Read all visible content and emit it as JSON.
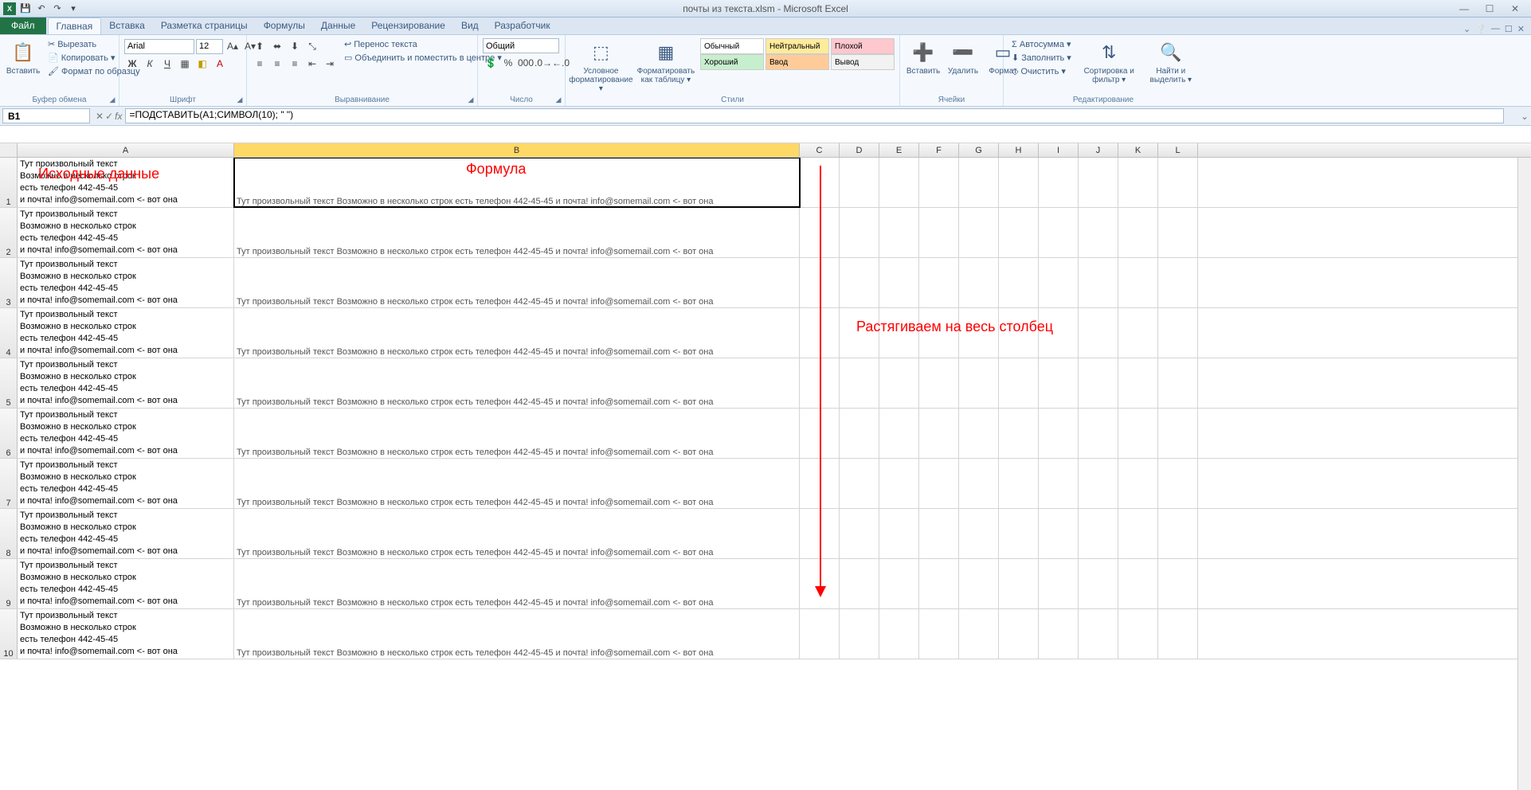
{
  "titlebar": {
    "title": "почты из текста.xlsm - Microsoft Excel",
    "qat_save": "💾",
    "qat_undo": "↶",
    "qat_redo": "↷"
  },
  "tabs": {
    "file": "Файл",
    "items": [
      "Главная",
      "Вставка",
      "Разметка страницы",
      "Формулы",
      "Данные",
      "Рецензирование",
      "Вид",
      "Разработчик"
    ],
    "active_index": 0
  },
  "ribbon": {
    "clipboard": {
      "paste": "Вставить",
      "cut": "Вырезать",
      "copy": "Копировать ▾",
      "format_painter": "Формат по образцу",
      "group": "Буфер обмена"
    },
    "font": {
      "name": "Arial",
      "size": "12",
      "group": "Шрифт"
    },
    "alignment": {
      "wrap": "Перенос текста",
      "merge": "Объединить и поместить в центре ▾",
      "group": "Выравнивание"
    },
    "number": {
      "format": "Общий",
      "group": "Число"
    },
    "styles": {
      "cond": "Условное форматирование ▾",
      "table": "Форматировать как таблицу ▾",
      "cells_styles": [
        "Обычный",
        "Нейтральный",
        "Плохой",
        "Хороший",
        "Ввод",
        "Вывод"
      ],
      "group": "Стили"
    },
    "cells": {
      "insert": "Вставить",
      "delete": "Удалить",
      "format": "Формат",
      "group": "Ячейки"
    },
    "editing": {
      "autosum": "Σ Автосумма ▾",
      "fill": "Заполнить ▾",
      "clear": "Очистить ▾",
      "sort": "Сортировка и фильтр ▾",
      "find": "Найти и выделить ▾",
      "group": "Редактирование"
    }
  },
  "formula_bar": {
    "name_box": "B1",
    "formula": "=ПОДСТАВИТЬ(A1;СИМВОЛ(10); \" \")"
  },
  "columns": {
    "A_width": 272,
    "B_width": 710,
    "rest_width": 50,
    "letters": [
      "A",
      "B",
      "C",
      "D",
      "E",
      "F",
      "G",
      "H",
      "I",
      "J",
      "K",
      "L"
    ]
  },
  "cell_a_text": "Тут произвольный текст\nВозможно в несколько строк\nесть телефон 442-45-45\nи почта! info@somemail.com <- вот она",
  "cell_b_text": "Тут произвольный текст Возможно в несколько строк есть телефон 442-45-45 и почта! info@somemail.com <- вот она",
  "row_count": 10,
  "annotations": {
    "source": "Исходные данные",
    "formula": "Формула",
    "stretch": "Растягиваем на весь столбец"
  }
}
